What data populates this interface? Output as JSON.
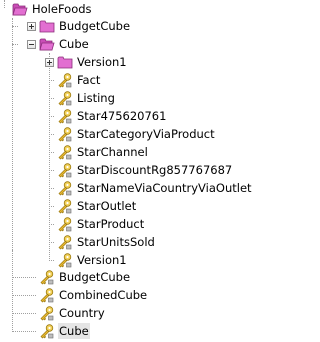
{
  "tree": {
    "root": {
      "label": "HoleFoods",
      "icon": "folder-open-icon",
      "expanded": true
    },
    "folders": [
      {
        "label": "BudgetCube",
        "icon": "folder-closed-icon",
        "expanded": false
      },
      {
        "label": "Cube",
        "icon": "folder-open-icon",
        "expanded": true
      }
    ],
    "version_folder": {
      "label": "Version1",
      "icon": "folder-closed-icon",
      "expanded": false
    },
    "cube_items": [
      {
        "label": "Fact"
      },
      {
        "label": "Listing"
      },
      {
        "label": "Star475620761"
      },
      {
        "label": "StarCategoryViaProduct"
      },
      {
        "label": "StarChannel"
      },
      {
        "label": "StarDiscountRg857767687"
      },
      {
        "label": "StarNameViaCountryViaOutlet"
      },
      {
        "label": "StarOutlet"
      },
      {
        "label": "StarProduct"
      },
      {
        "label": "StarUnitsSold"
      },
      {
        "label": "Version1"
      }
    ],
    "root_items": [
      {
        "label": "BudgetCube"
      },
      {
        "label": "CombinedCube"
      },
      {
        "label": "Country"
      },
      {
        "label": "Cube",
        "selected": true
      }
    ],
    "colors": {
      "folder_pink": "#e26fd1",
      "key_gold": "#e8b830",
      "selection_bg": "#e5e5e5",
      "connector": "#a0a0a0"
    }
  }
}
